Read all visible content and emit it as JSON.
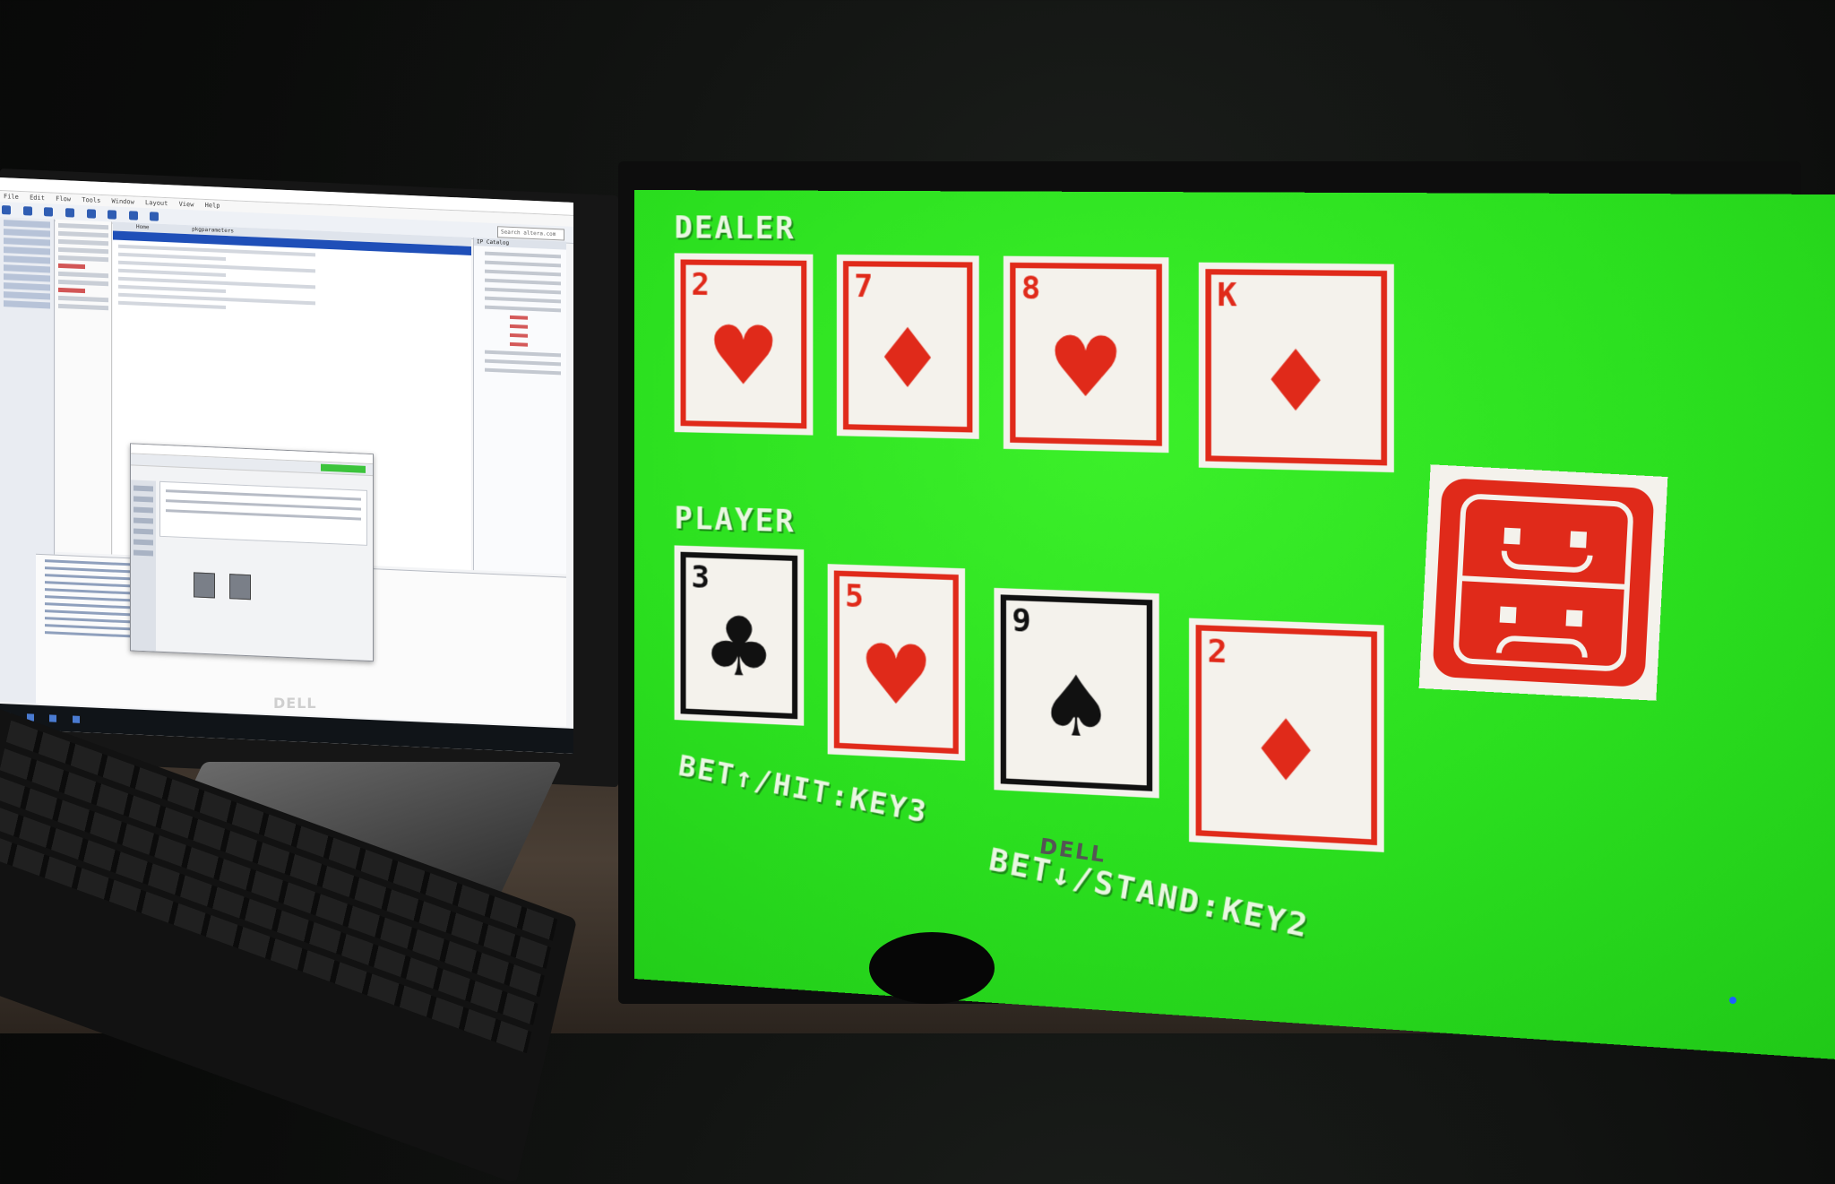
{
  "left_monitor": {
    "brand": "DELL",
    "app": {
      "title": "",
      "menu": [
        "File",
        "Edit",
        "Flow",
        "Tools",
        "Window",
        "Layout",
        "View",
        "Help"
      ],
      "search_placeholder": "Search altera.com",
      "tabs": [
        "",
        "Home",
        "",
        "pkgparameters"
      ],
      "catalog_title": "IP Catalog"
    },
    "sticker_text": ""
  },
  "right_monitor": {
    "brand": "DELL",
    "game": {
      "dealer_label": "DEALER",
      "player_label": "PLAYER",
      "dealer_cards": [
        {
          "rank": "2",
          "suit": "heart-icon",
          "color": "red"
        },
        {
          "rank": "7",
          "suit": "diamond-icon",
          "color": "red"
        },
        {
          "rank": "8",
          "suit": "heart-icon",
          "color": "red"
        },
        {
          "rank": "K",
          "suit": "diamond-icon",
          "color": "red"
        }
      ],
      "player_cards": [
        {
          "rank": "3",
          "suit": "club-icon",
          "color": "black"
        },
        {
          "rank": "5",
          "suit": "heart-icon",
          "color": "red"
        },
        {
          "rank": "9",
          "suit": "spade-icon",
          "color": "black"
        },
        {
          "rank": "2",
          "suit": "diamond-icon",
          "color": "red"
        }
      ],
      "instruction_hit": "BET↑/HIT:KEY3",
      "instruction_stand": "BET↓/STAND:KEY2",
      "status_icon": "dealer-bust-face-icon",
      "colors": {
        "background": "#2bdf1f",
        "card_red": "#e02a1a",
        "card_face": "#f4f2ec",
        "text": "#e9f7e1"
      }
    }
  }
}
